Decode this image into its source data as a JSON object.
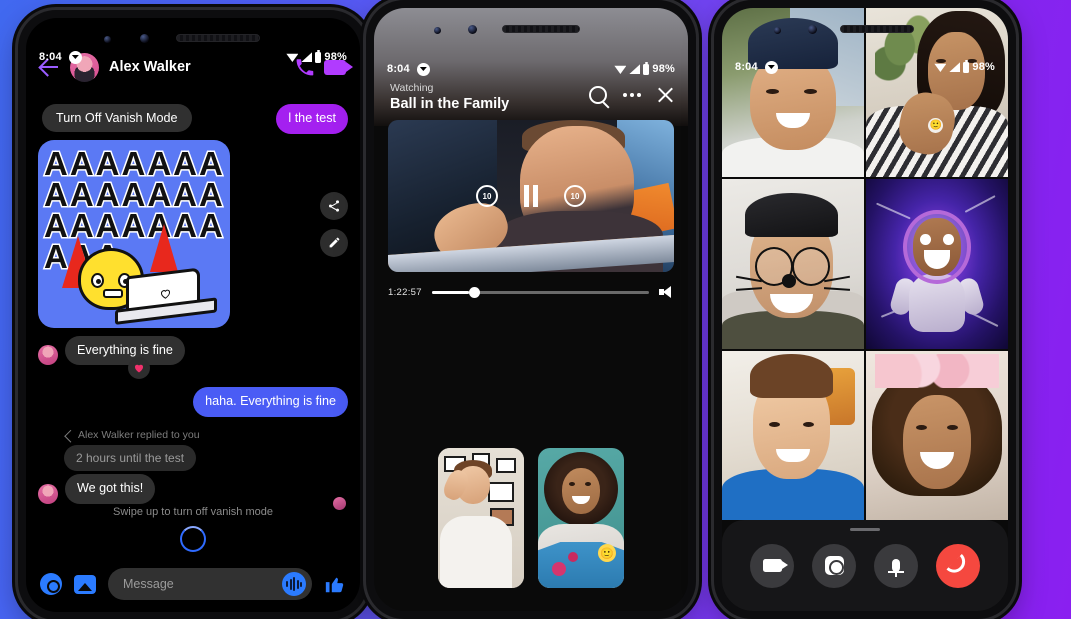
{
  "background": {
    "from": "#4169f0",
    "to": "#8a1ff0"
  },
  "phone1": {
    "status": {
      "time": "8:04",
      "battery": "98%",
      "messenger_icon": "messenger-dot"
    },
    "header": {
      "name": "Alex Walker",
      "back_icon": "back-arrow-icon",
      "call_icon": "phone-call-icon",
      "video_icon": "video-camera-icon"
    },
    "vanish_tooltip": "Turn Off Vanish Mode",
    "vanish_message": "l the test",
    "sticker": {
      "letters": "AAAAAAAAAAAAAAAAAAAAAAAA",
      "share_icon": "share-icon",
      "edit_icon": "pencil-edit-icon"
    },
    "messages": [
      {
        "side": "in",
        "text": "Everything is fine"
      },
      {
        "side": "out",
        "text": "haha. Everything is fine"
      }
    ],
    "reaction": "heart-reaction",
    "reply_meta": "Alex Walker replied to you",
    "quoted": "2 hours until the test",
    "reply_text": "We got this!",
    "swipe_hint": "Swipe up to turn off vanish mode",
    "composer": {
      "camera_icon": "camera-icon",
      "gallery_icon": "gallery-icon",
      "placeholder": "Message",
      "mic_icon": "voice-wave-icon",
      "thumbs_icon": "thumbs-up-icon"
    }
  },
  "phone2": {
    "status": {
      "time": "8:04",
      "battery": "98%"
    },
    "watching_label": "Watching",
    "title": "Ball in the Family",
    "actions": {
      "search": "search-icon",
      "more": "more-options-icon",
      "close": "close-icon"
    },
    "player": {
      "rewind": "rewind-10-icon",
      "rewind_label": "10",
      "pause": "pause-icon",
      "forward": "forward-10-icon",
      "forward_label": "10",
      "time": "1:22:57",
      "volume_icon": "volume-icon",
      "progress_percent": 17
    },
    "tiles": [
      {
        "name": "participant-tile-1"
      },
      {
        "name": "participant-tile-2",
        "badge": "🙂"
      }
    ]
  },
  "phone3": {
    "status": {
      "time": "8:04",
      "battery": "98%"
    },
    "participants": [
      {
        "name": "participant-1"
      },
      {
        "name": "participant-2",
        "badge": "🙂"
      },
      {
        "name": "participant-3"
      },
      {
        "name": "participant-4"
      },
      {
        "name": "participant-5"
      },
      {
        "name": "participant-6"
      }
    ],
    "call_controls": [
      {
        "name": "toggle-video-button",
        "icon": "video-camera-icon"
      },
      {
        "name": "flip-camera-button",
        "icon": "flip-camera-icon"
      },
      {
        "name": "toggle-mic-button",
        "icon": "microphone-icon"
      },
      {
        "name": "end-call-button",
        "icon": "end-call-icon"
      }
    ]
  }
}
